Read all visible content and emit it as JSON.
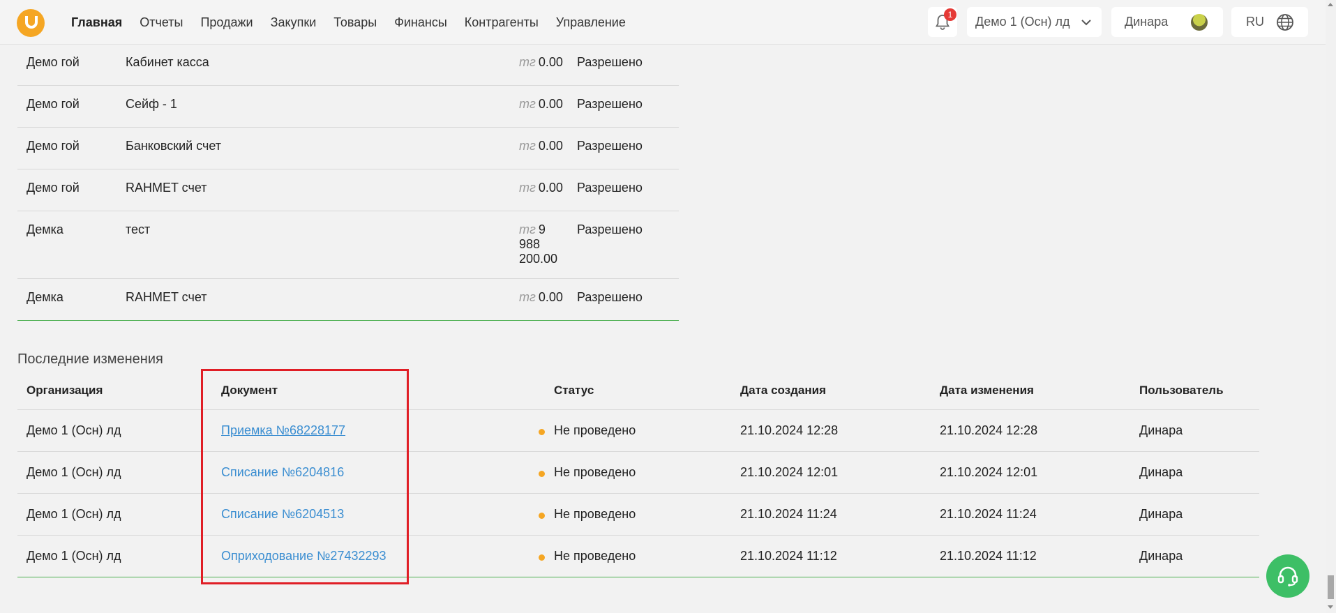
{
  "nav": {
    "items": [
      "Главная",
      "Отчеты",
      "Продажи",
      "Закупки",
      "Товары",
      "Финансы",
      "Контрагенты",
      "Управление"
    ],
    "active": "Главная"
  },
  "header": {
    "notifications_count": "1",
    "organization": "Демо 1 (Осн) лд",
    "user": "Динара",
    "language": "RU"
  },
  "accounts": [
    {
      "org": "Демо гой",
      "name": "Кабинет касса",
      "currency": "тг",
      "amount": "0.00",
      "status": "Разрешено"
    },
    {
      "org": "Демо гой",
      "name": "Сейф - 1",
      "currency": "тг",
      "amount": "0.00",
      "status": "Разрешено"
    },
    {
      "org": "Демо гой",
      "name": "Банковский счет",
      "currency": "тг",
      "amount": "0.00",
      "status": "Разрешено"
    },
    {
      "org": "Демо гой",
      "name": "RAHMET счет",
      "currency": "тг",
      "amount": "0.00",
      "status": "Разрешено"
    },
    {
      "org": "Демка",
      "name": "тест",
      "currency": "тг",
      "amount": "9 988 200.00",
      "status": "Разрешено"
    },
    {
      "org": "Демка",
      "name": "RAHMET счет",
      "currency": "тг",
      "amount": "0.00",
      "status": "Разрешено"
    }
  ],
  "changes": {
    "title": "Последние изменения",
    "headers": {
      "org": "Организация",
      "doc": "Документ",
      "status": "Статус",
      "created": "Дата создания",
      "modified": "Дата изменения",
      "user": "Пользователь"
    },
    "rows": [
      {
        "org": "Демо 1 (Осн) лд",
        "doc": "Приемка №68228177",
        "status": "Не проведено",
        "created": "21.10.2024 12:28",
        "modified": "21.10.2024 12:28",
        "user": "Динара"
      },
      {
        "org": "Демо 1 (Осн) лд",
        "doc": "Списание №6204816",
        "status": "Не проведено",
        "created": "21.10.2024 12:01",
        "modified": "21.10.2024 12:01",
        "user": "Динара"
      },
      {
        "org": "Демо 1 (Осн) лд",
        "doc": "Списание №6204513",
        "status": "Не проведено",
        "created": "21.10.2024 11:24",
        "modified": "21.10.2024 11:24",
        "user": "Динара"
      },
      {
        "org": "Демо 1 (Осн) лд",
        "doc": "Оприходование №27432293",
        "status": "Не проведено",
        "created": "21.10.2024 11:12",
        "modified": "21.10.2024 11:12",
        "user": "Динара"
      }
    ],
    "status_dot_color": "#f5a623"
  },
  "colors": {
    "link": "#3b8ed1",
    "highlight": "#e01e26",
    "accent_green": "#3dbf66",
    "brand": "#f5a623"
  }
}
